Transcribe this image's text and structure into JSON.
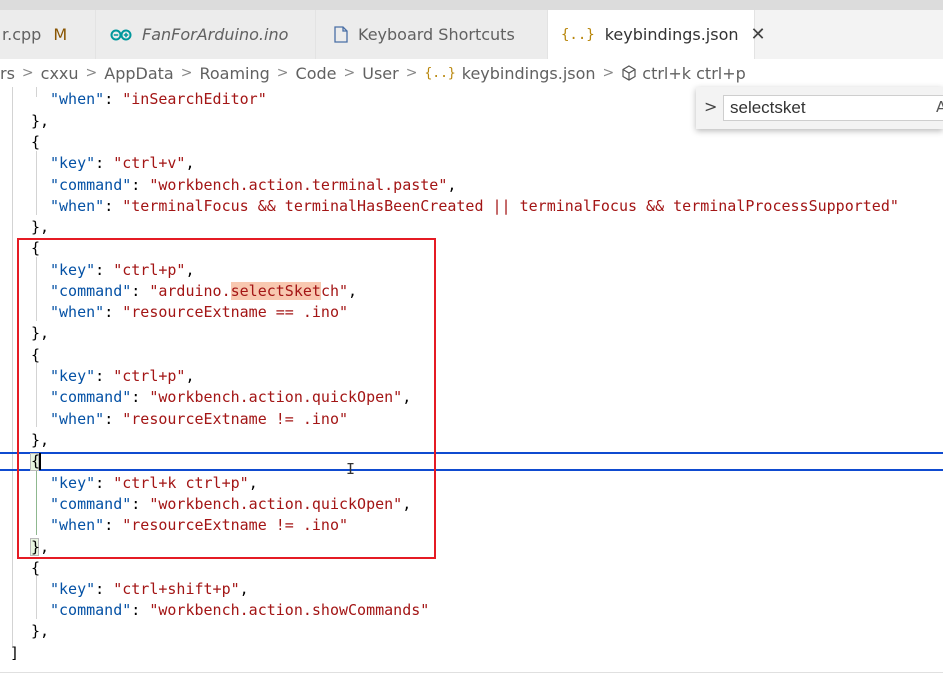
{
  "tabs": [
    {
      "label": "r.cpp",
      "badge": "M",
      "icon": "cpp-file-icon",
      "italic": false,
      "active": false
    },
    {
      "label": "FanForArduino.ino",
      "icon": "arduino-icon",
      "italic": true,
      "active": false
    },
    {
      "label": "Keyboard Shortcuts",
      "icon": "document-icon",
      "italic": false,
      "active": false
    },
    {
      "label": "keybindings.json",
      "icon": "json-braces-icon",
      "italic": false,
      "active": true,
      "close": "✕"
    }
  ],
  "breadcrumb": [
    "rs",
    "cxxu",
    "AppData",
    "Roaming",
    "Code",
    "User",
    "keybindings.json",
    "ctrl+k ctrl+p"
  ],
  "breadcrumb_separator": ">",
  "find": {
    "value": "selectsket",
    "expand_glyph": ">",
    "option_glyph": "A"
  },
  "code": {
    "l1": {
      "key": "\"when\"",
      "colon": ": ",
      "val": "\"inSearchEditor\""
    },
    "l2": "},",
    "l3": "{",
    "l4": {
      "key": "\"key\"",
      "colon": ": ",
      "val": "\"ctrl+v\"",
      "tail": ","
    },
    "l5": {
      "key": "\"command\"",
      "colon": ": ",
      "val": "\"workbench.action.terminal.paste\"",
      "tail": ","
    },
    "l6": {
      "key": "\"when\"",
      "colon": ": ",
      "val": "\"terminalFocus && terminalHasBeenCreated || terminalFocus && terminalProcessSupported\""
    },
    "l7": "},",
    "l8": "{",
    "l9": {
      "key": "\"key\"",
      "colon": ": ",
      "val": "\"ctrl+p\"",
      "tail": ","
    },
    "l10": {
      "key": "\"command\"",
      "colon": ": ",
      "val_pre": "\"arduino.",
      "val_hl": "selectSket",
      "val_post": "ch\"",
      "tail": ","
    },
    "l11": {
      "key": "\"when\"",
      "colon": ": ",
      "val": "\"resourceExtname == .ino\""
    },
    "l12": "},",
    "l13": "{",
    "l14": {
      "key": "\"key\"",
      "colon": ": ",
      "val": "\"ctrl+p\"",
      "tail": ","
    },
    "l15": {
      "key": "\"command\"",
      "colon": ": ",
      "val": "\"workbench.action.quickOpen\"",
      "tail": ","
    },
    "l16": {
      "key": "\"when\"",
      "colon": ": ",
      "val": "\"resourceExtname != .ino\""
    },
    "l17": "},",
    "l18": "{",
    "l19": {
      "key": "\"key\"",
      "colon": ": ",
      "val": "\"ctrl+k ctrl+p\"",
      "tail": ","
    },
    "l20": {
      "key": "\"command\"",
      "colon": ": ",
      "val": "\"workbench.action.quickOpen\"",
      "tail": ","
    },
    "l21": {
      "key": "\"when\"",
      "colon": ": ",
      "val": "\"resourceExtname != .ino\""
    },
    "l22_brace": "}",
    "l22_tail": ",",
    "l23": "{",
    "l24": {
      "key": "\"key\"",
      "colon": ": ",
      "val": "\"ctrl+shift+p\"",
      "tail": ","
    },
    "l25": {
      "key": "\"command\"",
      "colon": ": ",
      "val": "\"workbench.action.showCommands\""
    },
    "l26": "},",
    "l27": "]"
  },
  "colors": {
    "key": "#0451a5",
    "string": "#a31515",
    "annotation_box": "#e51b24",
    "current_line": "#0f4bd0",
    "find_highlight": "#f8c8b0"
  }
}
